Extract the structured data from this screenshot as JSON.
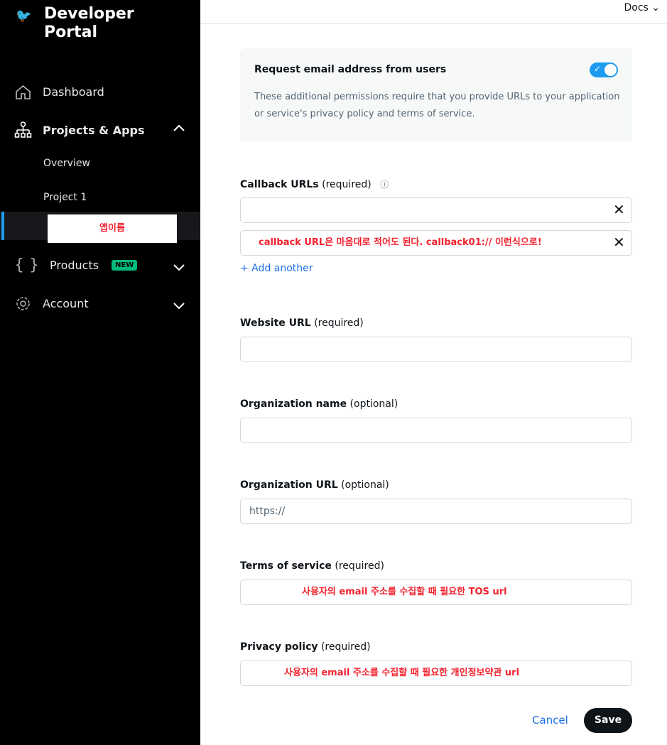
{
  "brand": {
    "line1": "Developer",
    "line2": "Portal"
  },
  "nav": {
    "dashboard": "Dashboard",
    "projects": "Projects & Apps",
    "overview": "Overview",
    "project1": "Project 1",
    "appname": "앱이름",
    "products": "Products",
    "new_badge": "NEW",
    "account": "Account"
  },
  "top": {
    "docs": "Docs"
  },
  "perm": {
    "title": "Request email address from users",
    "desc": "These additional permissions require that you provide URLs to your application or service's privacy policy and terms of service."
  },
  "form": {
    "callback": "Callback URLs",
    "required": "(required)",
    "optional": "(optional)",
    "callback_note": "callback URL은 마음대로 적어도 된다. callback01:// 이런식으로!",
    "add": "+ Add another",
    "website": "Website URL",
    "org_name": "Organization name",
    "org_url": "Organization URL",
    "org_url_ph": "https://",
    "tos": "Terms of service",
    "tos_note": "사용자의 email 주소를 수집할 때 필요한 TOS url",
    "privacy": "Privacy policy",
    "privacy_note": "사용자의 email 주소를 수집할 때 필요한 개인정보약관 url",
    "cancel": "Cancel",
    "save": "Save"
  }
}
